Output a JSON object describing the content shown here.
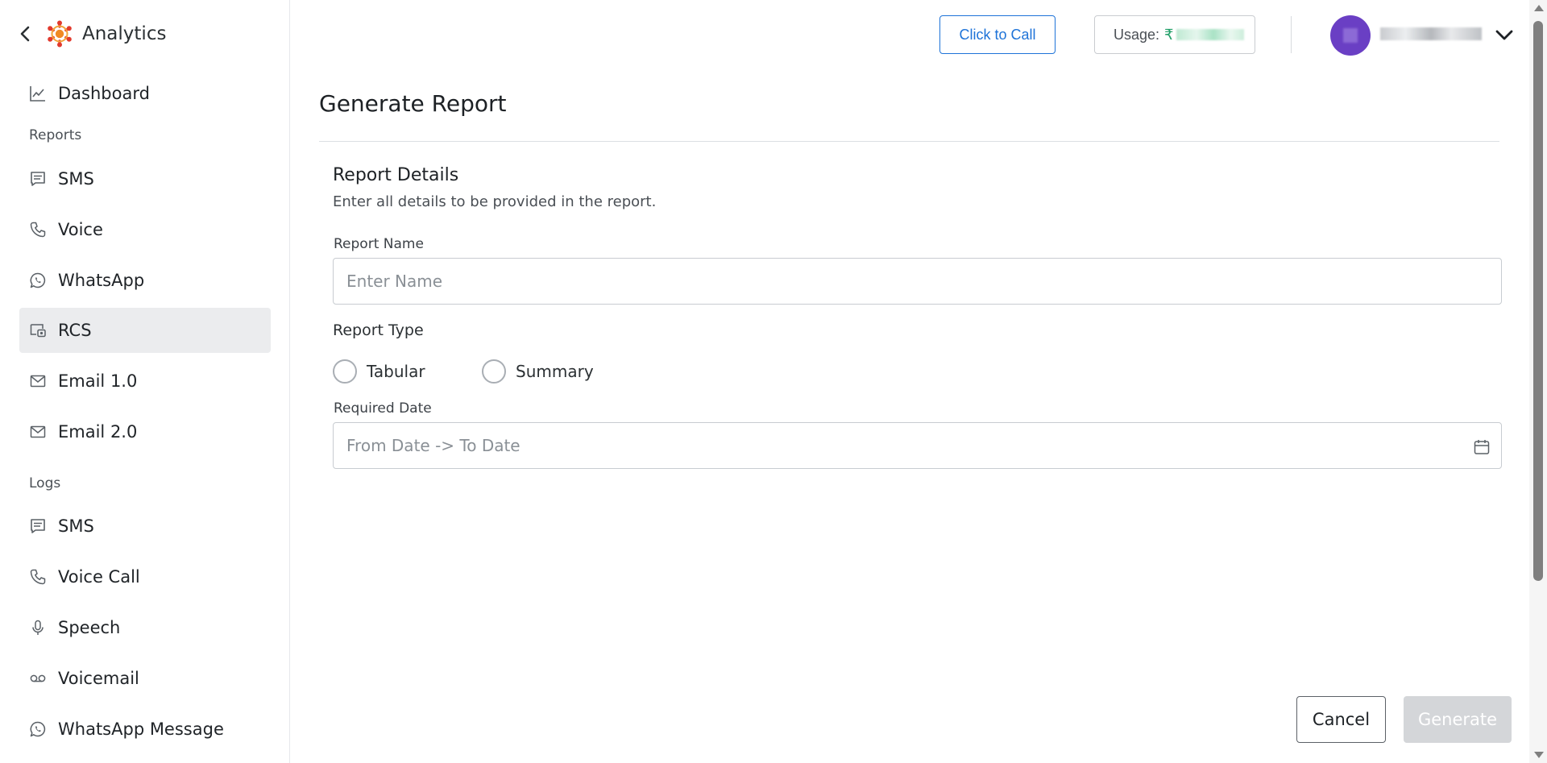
{
  "app": {
    "title": "Analytics"
  },
  "sidebar": {
    "dashboard": {
      "label": "Dashboard",
      "icon": "line-chart-icon"
    },
    "reports_heading": "Reports",
    "reports": [
      {
        "label": "SMS",
        "icon": "message-icon"
      },
      {
        "label": "Voice",
        "icon": "phone-icon"
      },
      {
        "label": "WhatsApp",
        "icon": "whatsapp-icon"
      },
      {
        "label": "RCS",
        "icon": "rcs-icon",
        "active": true
      },
      {
        "label": "Email 1.0",
        "icon": "mail-icon"
      },
      {
        "label": "Email 2.0",
        "icon": "mail-icon"
      }
    ],
    "logs_heading": "Logs",
    "logs": [
      {
        "label": "SMS",
        "icon": "message-icon"
      },
      {
        "label": "Voice Call",
        "icon": "phone-icon"
      },
      {
        "label": "Speech",
        "icon": "microphone-icon"
      },
      {
        "label": "Voicemail",
        "icon": "voicemail-icon"
      },
      {
        "label": "WhatsApp Message",
        "icon": "whatsapp-icon"
      }
    ]
  },
  "header": {
    "call_button": "Click to Call",
    "usage_label": "Usage:",
    "usage_currency": "₹",
    "accent_color": "#1e73d8",
    "avatar_color": "#6a3fc4"
  },
  "main": {
    "title": "Generate Report",
    "section_title": "Report Details",
    "section_subtitle": "Enter all details to be provided in the report.",
    "report_name_label": "Report Name",
    "report_name_placeholder": "Enter Name",
    "report_name_value": "",
    "report_type_label": "Report Type",
    "report_type_options": [
      "Tabular",
      "Summary"
    ],
    "required_date_label": "Required Date",
    "date_placeholder": "From Date -> To Date",
    "cancel_button": "Cancel",
    "generate_button": "Generate"
  }
}
